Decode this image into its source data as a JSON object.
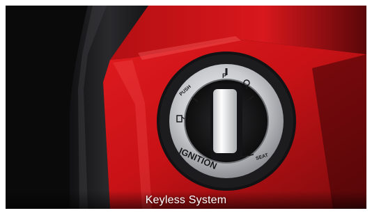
{
  "caption": {
    "text": "Keyless System"
  },
  "ignition_ring": {
    "brand_word": "IGNITION",
    "labels": [
      "PUSH",
      "P",
      "SEAT"
    ]
  },
  "colors": {
    "body_red": "#d4151a",
    "dark_red": "#6e0a0c",
    "trim_black": "#1b1b1d",
    "chrome": "#cfd1d4"
  }
}
